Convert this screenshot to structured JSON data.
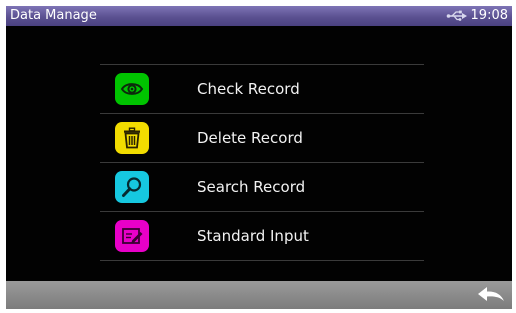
{
  "status_bar": {
    "title": "Data Manage",
    "connection_icon": "usb-icon",
    "time": "19:08"
  },
  "menu": {
    "items": [
      {
        "label": "Check Record",
        "icon": "eye-icon",
        "icon_color": "#00c400"
      },
      {
        "label": "Delete Record",
        "icon": "trash-icon",
        "icon_color": "#f2dc00"
      },
      {
        "label": "Search Record",
        "icon": "magnifier-icon",
        "icon_color": "#16c8e0"
      },
      {
        "label": "Standard Input",
        "icon": "edit-icon",
        "icon_color": "#e800c8"
      }
    ]
  },
  "bottom_bar": {
    "back_icon": "back-arrow-icon"
  },
  "colors": {
    "status_bar": "#5b5191",
    "background": "#020202",
    "bottom_bar": "#8a8a8a",
    "divider": "#3a3a3a"
  }
}
